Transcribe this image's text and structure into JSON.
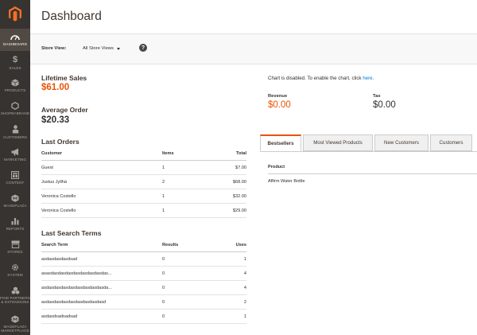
{
  "sidebar": {
    "logo": "magento-logo",
    "items": [
      {
        "label": "DASHBOARD",
        "icon": "speedometer-icon",
        "active": true
      },
      {
        "label": "SALES",
        "icon": "dollar-icon"
      },
      {
        "label": "PRODUCTS",
        "icon": "cube-icon"
      },
      {
        "label": "SHOPBYBRAND",
        "icon": "hexagon-icon"
      },
      {
        "label": "CUSTOMERS",
        "icon": "person-icon"
      },
      {
        "label": "MARKETING",
        "icon": "megaphone-icon"
      },
      {
        "label": "CONTENT",
        "icon": "layout-icon"
      },
      {
        "label": "MAGEPLAZA",
        "icon": "mageplaza-icon"
      },
      {
        "label": "REPORTS",
        "icon": "bar-chart-icon"
      },
      {
        "label": "STORES",
        "icon": "storefront-icon"
      },
      {
        "label": "SYSTEM",
        "icon": "gear-icon"
      },
      {
        "label": "FIND PARTNERS & EXTENSIONS",
        "icon": "cubes-icon"
      },
      {
        "label": "MAGEPLAZA MARKETPLACE",
        "icon": "mageplaza-icon"
      }
    ]
  },
  "header": {
    "title": "Dashboard"
  },
  "store_bar": {
    "label": "Store View:",
    "selected": "All Store Views",
    "help": "?"
  },
  "stats": {
    "lifetime_sales_label": "Lifetime Sales",
    "lifetime_sales_value": "$61.00",
    "average_order_label": "Average Order",
    "average_order_value": "$20.33"
  },
  "last_orders": {
    "title": "Last Orders",
    "headers": {
      "customer": "Customer",
      "items": "Items",
      "total": "Total"
    },
    "rows": [
      {
        "customer": "Guest",
        "items": "1",
        "total": "$7.00"
      },
      {
        "customer": "Justus Jyllhä",
        "items": "2",
        "total": "$68.00"
      },
      {
        "customer": "Veronica Costello",
        "items": "1",
        "total": "$32.00"
      },
      {
        "customer": "Veronica Costello",
        "items": "1",
        "total": "$29.00"
      }
    ]
  },
  "search_terms": {
    "title": "Last Search Terms",
    "headers": {
      "term": "Search Term",
      "results": "Results",
      "uses": "Uses"
    },
    "rows": [
      {
        "term": "asdasdasdasdsad",
        "results": "0",
        "uses": "1"
      },
      {
        "term": "asasdasdasdasdasdasdasdasdas...",
        "results": "0",
        "uses": "4"
      },
      {
        "term": "asdasdasdasdasdasdasdasdasda...",
        "results": "0",
        "uses": "4"
      },
      {
        "term": "asdasdasdasdasdasdasdasdasd",
        "results": "0",
        "uses": "2"
      },
      {
        "term": "asdasdsadsadsad",
        "results": "0",
        "uses": "1"
      }
    ]
  },
  "chart": {
    "disabled_text": "Chart is disabled. To enable the chart, click ",
    "link": "here."
  },
  "totals": {
    "revenue_label": "Revenue",
    "revenue_value": "$0.00",
    "tax_label": "Tax",
    "tax_value": "$0.00"
  },
  "tabs": [
    {
      "label": "Bestsellers",
      "active": true
    },
    {
      "label": "Most Viewed Products"
    },
    {
      "label": "New Customers"
    },
    {
      "label": "Customers"
    }
  ],
  "bestsellers": {
    "header_product": "Product",
    "rows": [
      {
        "product": "Affirm Water Bottle"
      }
    ]
  },
  "colors": {
    "accent": "#eb5202",
    "sidebar": "#373330",
    "link": "#007bdb"
  }
}
